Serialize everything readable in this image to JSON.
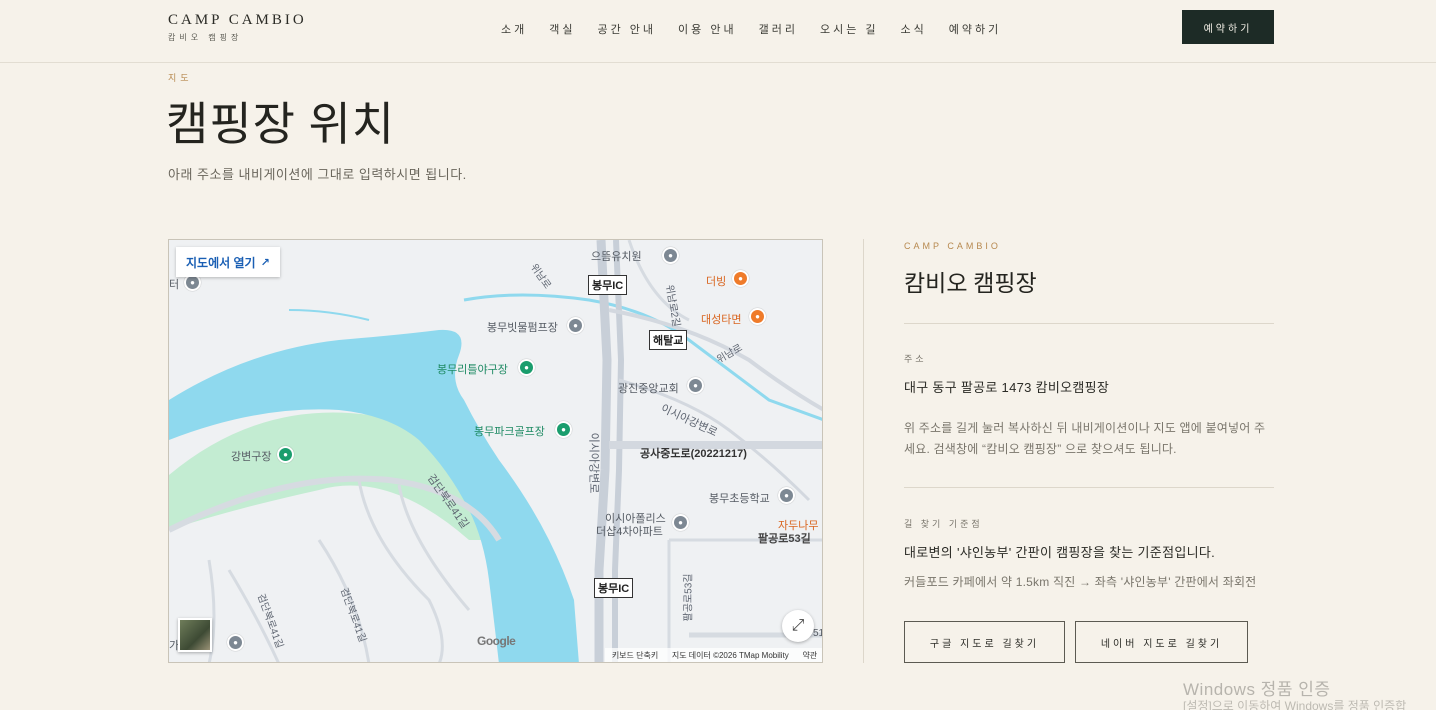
{
  "header": {
    "logo_en": "CAMP CAMBIO",
    "logo_ko": "캄비오 캠핑장",
    "nav": [
      "소개",
      "객실",
      "공간 안내",
      "이용 안내",
      "갤러리",
      "오시는 길",
      "소식",
      "예약하기"
    ],
    "cta": "예약하기"
  },
  "section": {
    "eyebrow": "지도",
    "title": "캠핑장 위치",
    "subtitle": "아래 주소를 내비게이션에 그대로 입력하시면 됩니다."
  },
  "map": {
    "open_label": "지도에서 열기",
    "google": "Google",
    "footer": [
      "키보드 단축키",
      "지도 데이터 ©2026 TMap Mobility",
      "약관"
    ],
    "labels": {
      "kindergarten": "으뜸유치원",
      "dubbing": "더빙",
      "daesung": "대성타면",
      "bongmu_ic_top": "봉무IC",
      "haetal": "해탈교",
      "pump": "봉무빗물펌프장",
      "rugby": "봉무리틀야구장",
      "church": "광진중앙교회",
      "park_golf": "봉무파크골프장",
      "isia_ro": "이시아강변로",
      "isia_ro2": "이시아강변로",
      "construction": "공사중도로(20221217)",
      "gangbyeon": "강변구장",
      "elementary": "봉무초등학교",
      "apartment1": "이시아폴리스",
      "apartment2": "더샵4차아파트",
      "jadu": "자두나무",
      "palgong53": "팔공로53길",
      "palgong53b": "팔공로53길",
      "bongmu_ic_bottom": "봉무IC",
      "geomdan41": "검단북로41길",
      "geomdan41b": "검단북로41길",
      "geomdan41c": "검단북로41길",
      "winam": "위남로",
      "winam2": "위남로2길",
      "winam3": "위남로",
      "ter": "터",
      "ga": "가",
      "num51": "51"
    }
  },
  "panel": {
    "eyebrow": "CAMP CAMBIO",
    "title": "캄비오 캠핑장",
    "address_label": "주소",
    "address": "대구 동구 팔공로 1473 캄비오캠핑장",
    "address_help": "위 주소를 길게 눌러 복사하신 뒤 내비게이션이나 지도 앱에 붙여넣어 주세요. 검색창에 “캄비오 캠핑장” 으로 찾으셔도 됩니다.",
    "guide_label": "길 찾기 기준점",
    "guide_strong": "대로변의 '샤인농부' 간판이 캠핑장을 찾는 기준점입니다.",
    "guide_text": "커들포드 카페에서 약 1.5km 직진 → 좌측 '샤인농부' 간판에서 좌회전",
    "btn_google": "구글 지도로 길찾기",
    "btn_naver": "네이버 지도로 길찾기"
  },
  "watermark": {
    "line1": "Windows 정품 인증",
    "line2": "[설정]으로 이동하여 Windows를 정품 인증합"
  },
  "colors": {
    "background": "#f6f2ea",
    "cta": "#1d2b26",
    "accent": "#b7894f",
    "water": "#8fd9ee",
    "park": "#c3ecd2"
  }
}
